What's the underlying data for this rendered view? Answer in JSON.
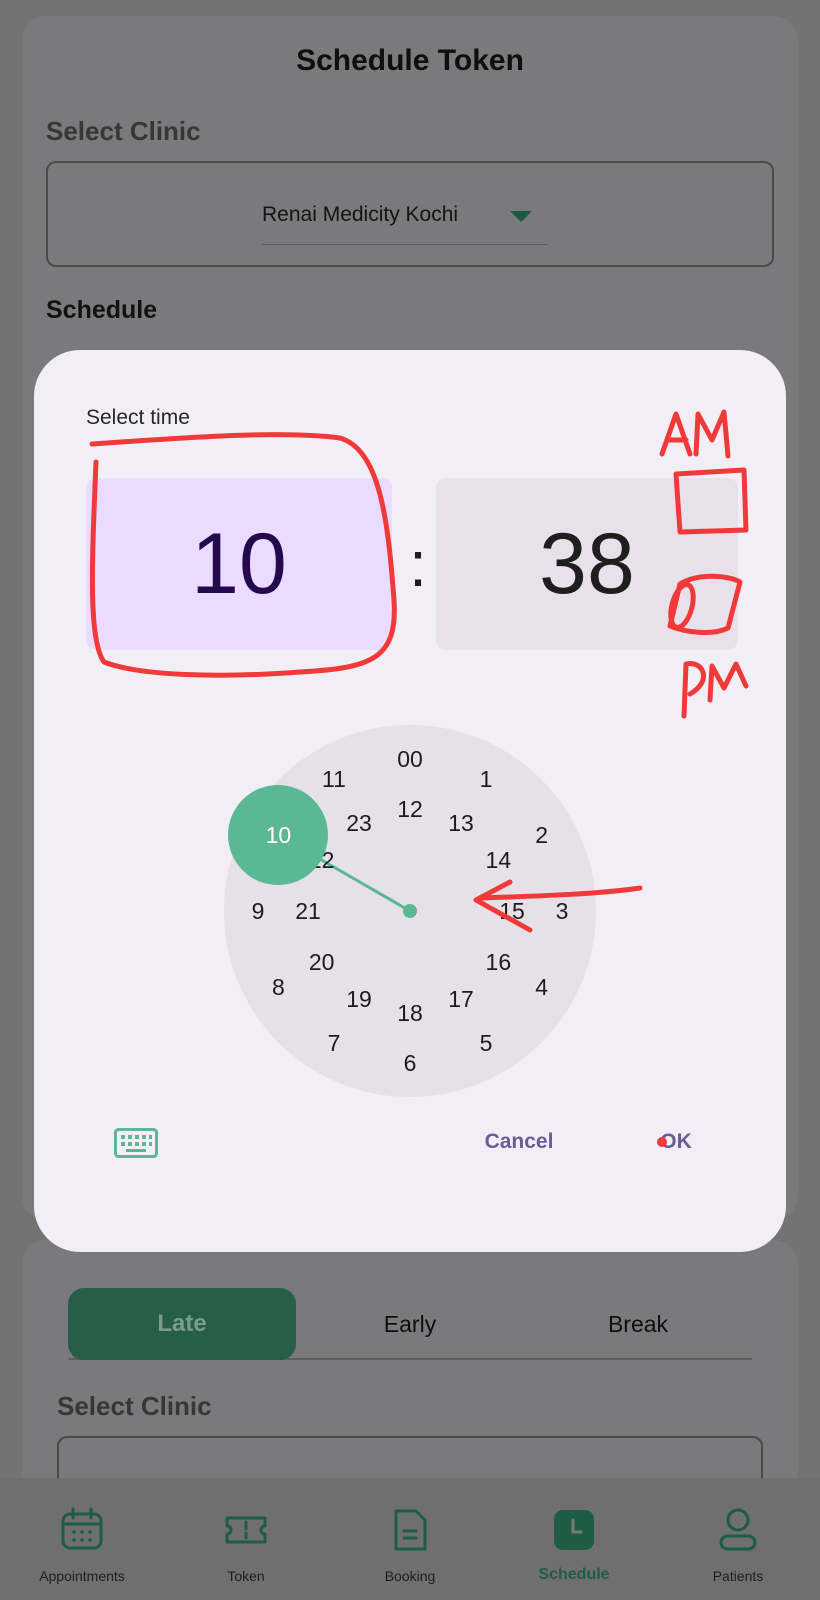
{
  "page": {
    "title": "Schedule Token",
    "select_clinic_label": "Select Clinic",
    "clinic_value": "Renai Medicity Kochi",
    "schedule_label": "Schedule",
    "tabs": [
      {
        "label": "Late",
        "active": true
      },
      {
        "label": "Early",
        "active": false
      },
      {
        "label": "Break",
        "active": false
      }
    ],
    "select_clinic_label_2": "Select Clinic"
  },
  "dialog": {
    "title": "Select time",
    "hour": "10",
    "separator": ":",
    "minute": "38",
    "dial": {
      "selected": "10",
      "outer": [
        "00",
        "1",
        "2",
        "3",
        "4",
        "5",
        "6",
        "7",
        "8",
        "9",
        "10",
        "11"
      ],
      "inner": [
        "12",
        "13",
        "14",
        "15",
        "16",
        "17",
        "18",
        "19",
        "20",
        "21",
        "22",
        "23"
      ]
    },
    "cancel_label": "Cancel",
    "ok_label": "OK",
    "keyboard_icon": "keyboard-icon"
  },
  "bottom_nav": {
    "items": [
      {
        "label": "Appointments",
        "icon": "calendar-icon"
      },
      {
        "label": "Token",
        "icon": "ticket-icon"
      },
      {
        "label": "Booking",
        "icon": "document-icon"
      },
      {
        "label": "Schedule",
        "icon": "clock-icon",
        "active": true
      },
      {
        "label": "Patients",
        "icon": "person-icon"
      }
    ]
  },
  "annotations": {
    "am_label": "AM",
    "pm_label": "PM"
  },
  "colors": {
    "accent": "#5ab895",
    "tab_active": "#275e48",
    "dialog_bg": "#f2eef6",
    "hour_bg": "#ebdcff",
    "action_text": "#6b5b96",
    "annotation_red": "#f03a3a"
  }
}
